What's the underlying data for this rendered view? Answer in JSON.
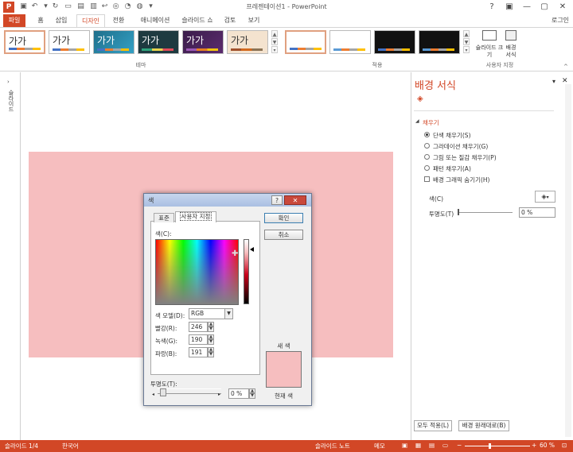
{
  "window": {
    "title": "프레젠테이션1 - PowerPoint",
    "login": "로그인"
  },
  "tabs": [
    "파일",
    "홈",
    "삽입",
    "디자인",
    "전환",
    "애니메이션",
    "슬라이드 쇼",
    "검토",
    "보기"
  ],
  "ribbon": {
    "theme_text": "가가",
    "group_theme": "테마",
    "group_variant": "적용",
    "group_customize": "사용자 지정",
    "slide_size": "슬라이드 크기",
    "format_background": "배경 서식"
  },
  "outline_tab": "슬라이드",
  "pane": {
    "title": "배경 서식",
    "section_fill": "채우기",
    "options": [
      "단색 채우기(S)",
      "그라데이션 채우기(G)",
      "그림 또는 질감 채우기(P)",
      "패턴 채우기(A)"
    ],
    "hide_graphics": "배경 그래픽 숨기기(H)",
    "color_label": "색(C)",
    "transparency_label": "투명도(T)",
    "transparency_value": "0 %",
    "apply_all": "모두 적용(L)",
    "reset": "배경 원래대로(B)"
  },
  "dialog": {
    "title": "색",
    "help": "?",
    "tab_standard": "표준",
    "tab_custom": "사용자 지정",
    "ok": "확인",
    "cancel": "취소",
    "colors_label": "색(C):",
    "model_label": "색 모델(D):",
    "model_value": "RGB",
    "red_label": "빨강(R):",
    "red_value": "246",
    "green_label": "녹색(G):",
    "green_value": "190",
    "blue_label": "파랑(B):",
    "blue_value": "191",
    "transparency_label": "투명도(T):",
    "transparency_value": "0 %",
    "new_label": "새 색",
    "current_label": "현재 색"
  },
  "status": {
    "slide": "슬라이드 1/4",
    "language": "한국어",
    "notes": "슬라이드 노트",
    "comments": "메모",
    "zoom": "60 %"
  },
  "colors": {
    "accent": "#d24726",
    "background": "#f6bebf"
  }
}
